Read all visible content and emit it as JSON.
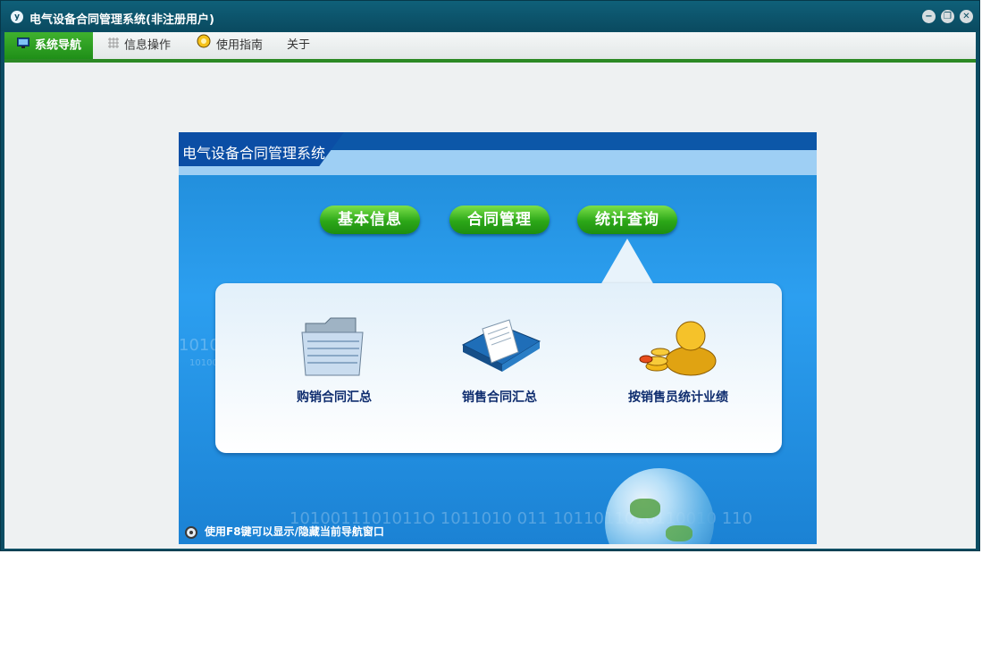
{
  "window": {
    "title": "电气设备合同管理系统(非注册用户)",
    "icon": "app-logo-icon",
    "controls": {
      "minimize": "−",
      "restore": "❐",
      "close": "✕"
    }
  },
  "menu": {
    "items": [
      {
        "label": "系统导航",
        "icon": "monitor-icon",
        "active": true
      },
      {
        "label": "信息操作",
        "icon": "grid-icon",
        "active": false
      },
      {
        "label": "使用指南",
        "icon": "guide-icon",
        "active": false
      },
      {
        "label": "关于",
        "icon": "",
        "active": false
      }
    ]
  },
  "nav_panel": {
    "title": "电气设备合同管理系统",
    "buttons": [
      "基本信息",
      "合同管理",
      "统计查询"
    ],
    "features": [
      {
        "label": "购销合同汇总",
        "icon": "folder-icon"
      },
      {
        "label": "销售合同汇总",
        "icon": "book-icon"
      },
      {
        "label": "按销售员统计业绩",
        "icon": "person-coins-icon"
      }
    ],
    "binary_bottom": "1010011101011O    1011010  011   1011011010110010       110",
    "binary_left": "1010",
    "binary_left_small": "10100",
    "hint": "使用F8键可以显示/隐藏当前导航窗口"
  },
  "colors": {
    "accent_green": "#2c8a25",
    "titlebar": "#0b4d63",
    "panel_blue": "#1f8ad6"
  }
}
